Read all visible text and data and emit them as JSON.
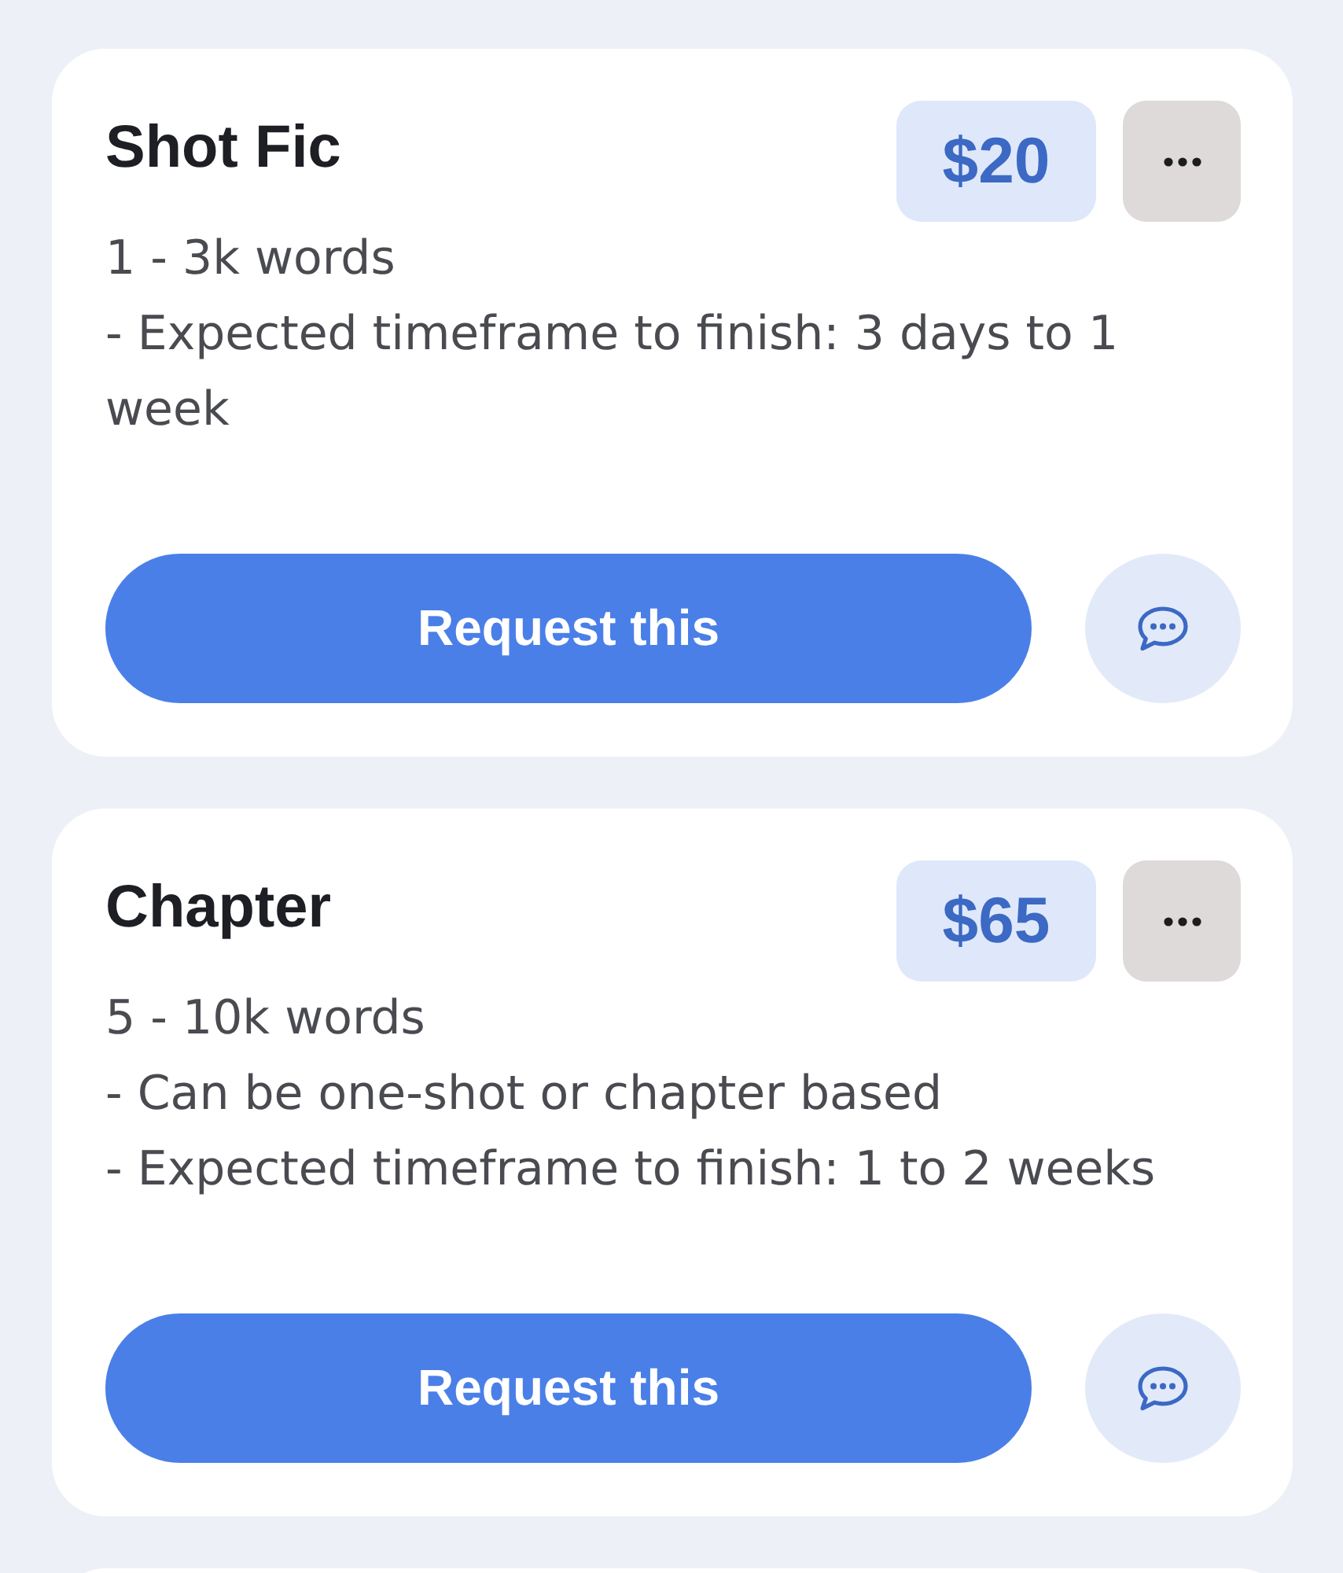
{
  "cards": [
    {
      "title": "Shot Fic",
      "price": "$20",
      "details": [
        "1 - 3k words",
        "- Expected timeframe to finish: 3 days to 1 week"
      ],
      "action": "Request this"
    },
    {
      "title": "Chapter",
      "price": "$65",
      "details": [
        "5 - 10k words",
        "- Can be one-shot or chapter based",
        "- Expected timeframe to finish: 1 to 2 weeks"
      ],
      "action": "Request this"
    }
  ],
  "more_below": true
}
